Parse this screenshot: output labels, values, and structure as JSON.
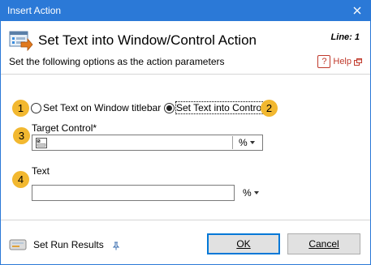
{
  "window": {
    "title": "Insert Action"
  },
  "header": {
    "title": "Set Text into Window/Control Action",
    "line": "Line: 1",
    "subtitle": "Set the following options as the action parameters",
    "help_label": "Help"
  },
  "badges": [
    "1",
    "2",
    "3",
    "4"
  ],
  "options": {
    "titlebar_label": "Set Text on Window titlebar",
    "control_label": "Set Text into Control",
    "selected": "control"
  },
  "target_control": {
    "label": "Target Control*",
    "value": "",
    "pct": "%"
  },
  "text_field": {
    "label": "Text",
    "value": "",
    "pct": "%"
  },
  "footer": {
    "run_results_label": "Set Run Results",
    "ok_label": "OK",
    "cancel_label": "Cancel"
  },
  "colors": {
    "titlebar": "#2b79d7",
    "badge": "#f2b830",
    "help": "#c0392b",
    "default_button_border": "#0078d7"
  }
}
